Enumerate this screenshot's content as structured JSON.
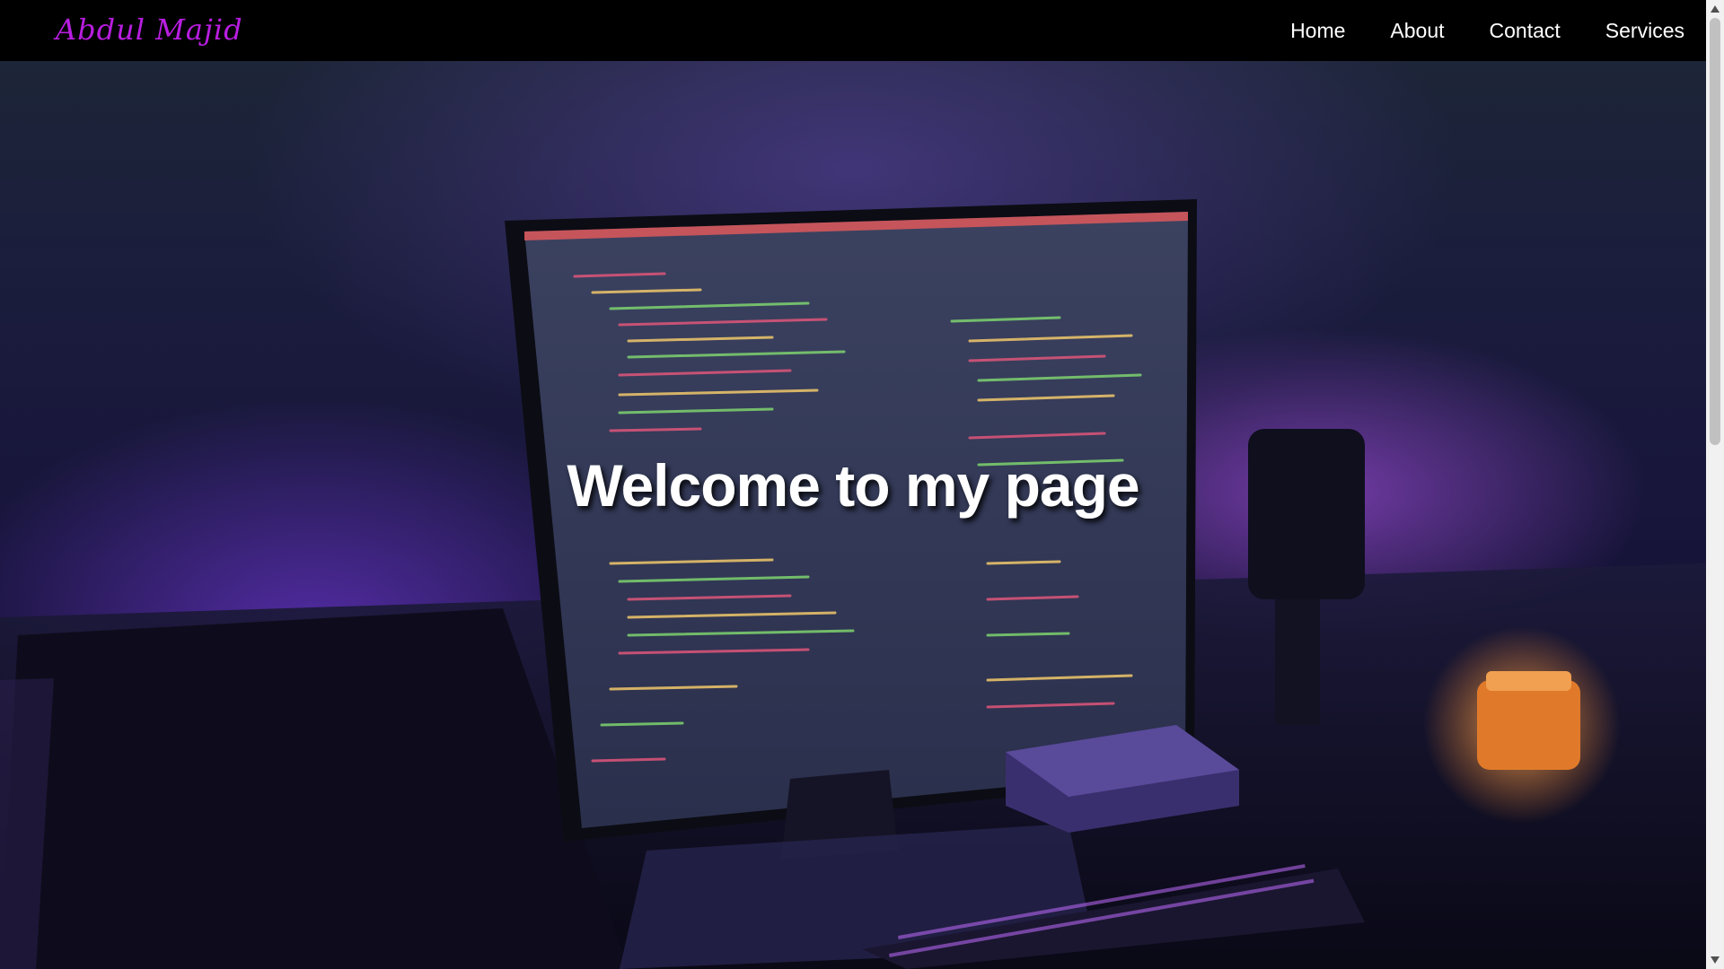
{
  "brand": {
    "name": "Abdul Majid",
    "color": "#b81ee0"
  },
  "nav": {
    "items": [
      {
        "label": "Home"
      },
      {
        "label": "About"
      },
      {
        "label": "Contact"
      },
      {
        "label": "Services"
      }
    ]
  },
  "hero": {
    "title": "Welcome to my page",
    "background_image": "dark desk workspace photo with monitor showing code, keyboard and candle, purple lighting"
  },
  "colors": {
    "navbar_bg": "#000000",
    "nav_text": "#ffffff",
    "accent_purple": "#9b45ff"
  },
  "icons": {
    "scroll_up": "triangle-up-icon",
    "scroll_down": "triangle-down-icon"
  }
}
